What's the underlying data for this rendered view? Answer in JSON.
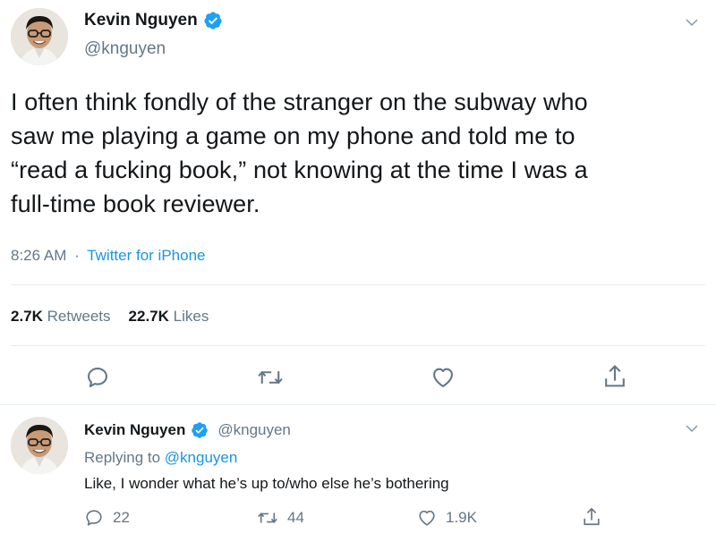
{
  "main_tweet": {
    "author": {
      "name": "Kevin Nguyen",
      "handle": "@knguyen",
      "verified": true
    },
    "text_lines": [
      "I often think fondly of the stranger on the subway who",
      "saw me playing a game on my phone and told me to",
      "“read a fucking book,” not knowing at the time I was a",
      "full-time book reviewer."
    ],
    "time": "8:26 AM",
    "separator": "·",
    "source": "Twitter for iPhone",
    "stats": {
      "retweets_count": "2.7K",
      "retweets_label": "Retweets",
      "likes_count": "22.7K",
      "likes_label": "Likes"
    },
    "actions": [
      "reply-icon",
      "retweet-icon",
      "like-icon",
      "share-icon"
    ]
  },
  "reply_tweet": {
    "author": {
      "name": "Kevin Nguyen",
      "handle": "@knguyen",
      "verified": true
    },
    "replying_to_label": "Replying to",
    "replying_to_handle": "@knguyen",
    "text": "Like, I wonder what he’s up to/who else he’s bothering",
    "counts": {
      "replies": "22",
      "retweets": "44",
      "likes": "1.9K"
    }
  },
  "colors": {
    "link": "#1b95e0",
    "muted": "#657786",
    "text": "#14171a",
    "divider": "#e6ecf0",
    "verified": "#1da1f2"
  }
}
